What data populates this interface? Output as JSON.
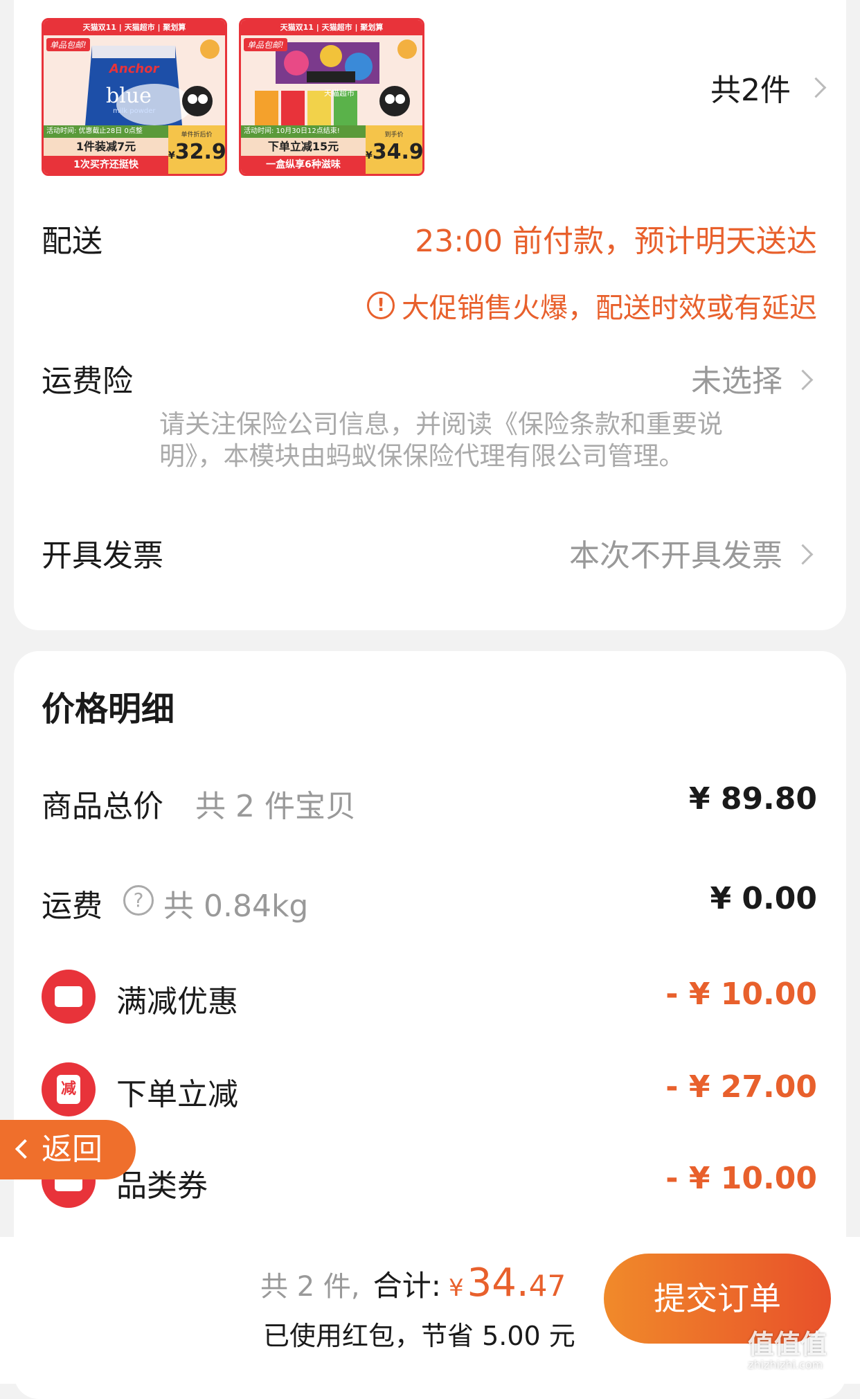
{
  "products": [
    {
      "banner": "天猫双11 | 天猫超市 | 聚划算",
      "tag": "单品包邮!",
      "brand": "Anchor",
      "name": "blue",
      "name_sub": "milk powder",
      "promo_line1": "活动时间: 优惠截止28日 0点整",
      "promo_line2": "1件装减7元",
      "promo_line3": "1次买齐还挺快",
      "price_label": "单件折后价",
      "currency": "¥",
      "price": "32.9"
    },
    {
      "banner": "天猫双11 | 天猫超市 | 聚划算",
      "tag": "单品包邮!",
      "brand": "天猫超市",
      "promo_line1": "活动时间: 10月30日12点结束!",
      "promo_line2": "下单立减15元",
      "promo_line3": "一盒纵享6种滋味",
      "price_label": "到手价",
      "currency": "¥",
      "price": "34.9"
    }
  ],
  "item_count_label": "共2件",
  "delivery": {
    "label": "配送",
    "value": "23:00 前付款，预计明天送达",
    "warning": "大促销售火爆，配送时效或有延迟"
  },
  "shipping_insurance": {
    "label": "运费险",
    "value": "未选择",
    "note_line1": "请关注保险公司信息，并阅读《保险条款和重要说",
    "note_line2": "明》，本模块由蚂蚁保保险代理有限公司管理。"
  },
  "invoice": {
    "label": "开具发票",
    "value": "本次不开具发票"
  },
  "price_detail": {
    "title": "价格明细",
    "goods_total_label": "商品总价",
    "goods_total_sub": "共 2 件宝贝",
    "goods_total_value": "¥ 89.80",
    "freight_label": "运费",
    "freight_sub": "共 0.84kg",
    "freight_value": "¥ 0.00",
    "discounts": [
      {
        "label": "满减优惠",
        "value": "- ¥ 10.00",
        "icon": "ticket-icon"
      },
      {
        "label": "下单立减",
        "value": "- ¥ 27.00",
        "icon": "jian-icon",
        "icon_text": "减"
      },
      {
        "label": "品类券",
        "value": "- ¥ 10.00",
        "icon": "coupon-icon"
      }
    ]
  },
  "back_button": "返回",
  "footer": {
    "count": "共 2 件,",
    "total_label": "合计:",
    "currency": "¥",
    "total_int": "34.",
    "total_dec": "47",
    "savings": "已使用红包，节省 5.00 元",
    "submit": "提交订单"
  },
  "watermark": {
    "main": "值值值",
    "sub": "zhizhizhi.com"
  },
  "colors": {
    "accent": "#e8602c",
    "red": "#e8333a",
    "submit_from": "#f08a2a",
    "submit_to": "#e8502a"
  }
}
